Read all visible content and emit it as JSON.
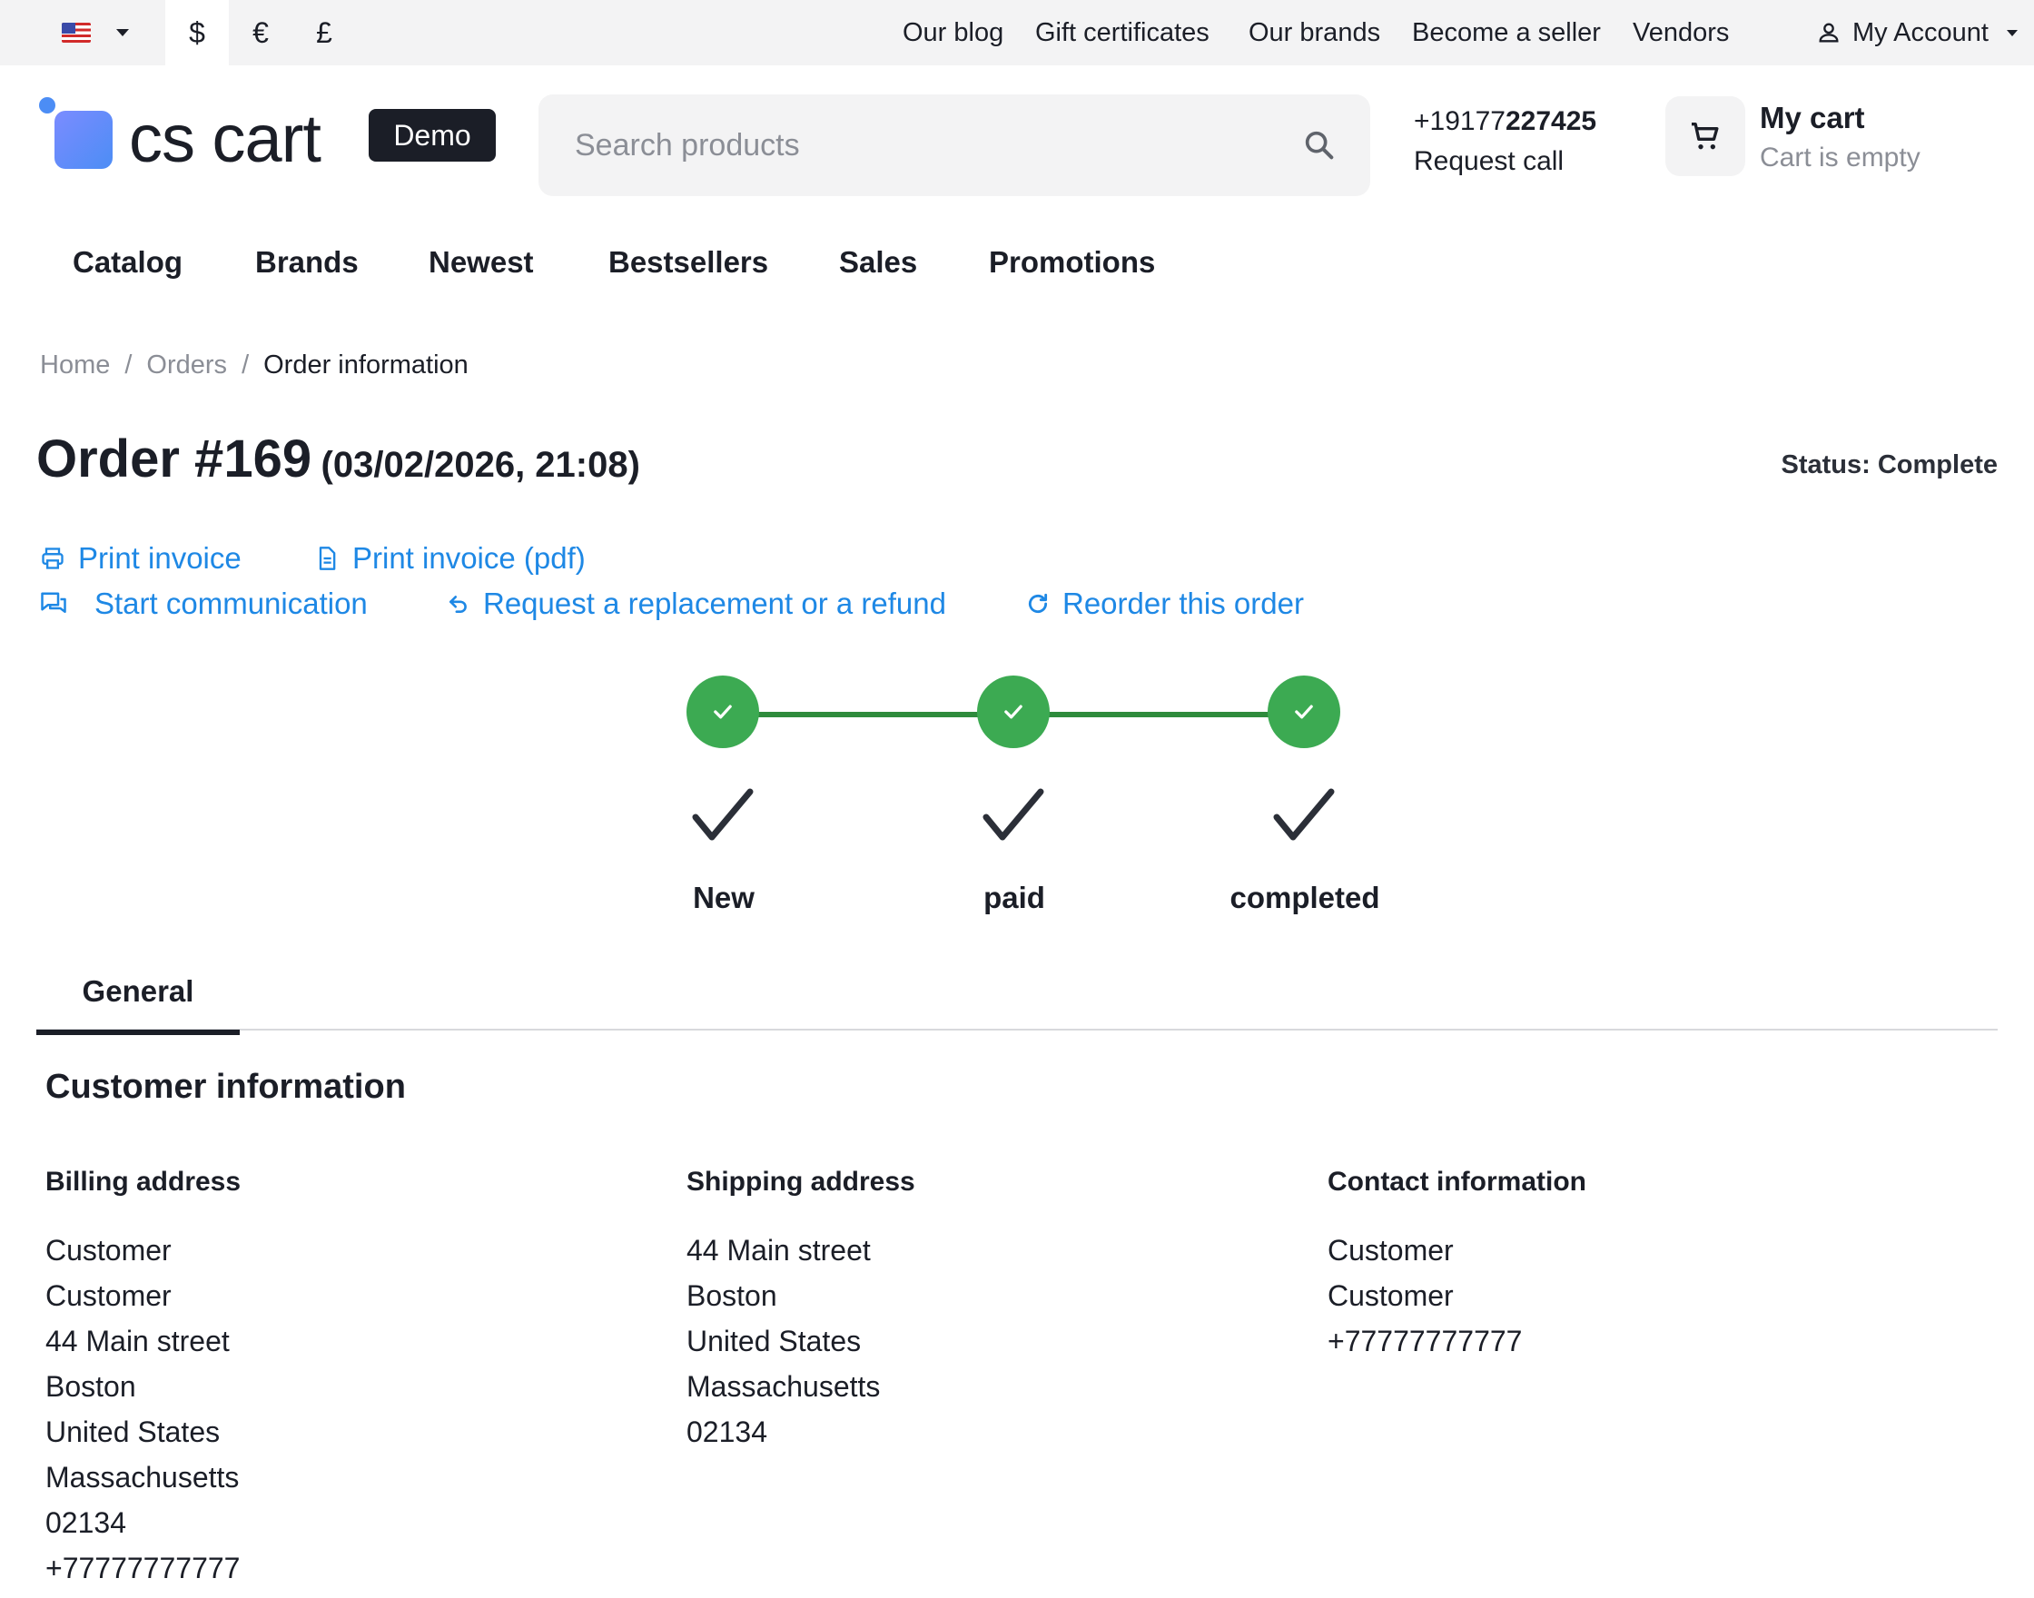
{
  "topbar": {
    "currencies": [
      "$",
      "€",
      "£"
    ],
    "links": [
      "Our blog",
      "Gift certificates",
      "Our brands",
      "Become a seller",
      "Vendors"
    ],
    "account_label": "My Account"
  },
  "header": {
    "logo_text": "cs cart",
    "demo_badge": "Demo",
    "search_placeholder": "Search products",
    "phone_prefix": "+19177",
    "phone_bold": "227425",
    "request_call": "Request call",
    "cart_title": "My cart",
    "cart_status": "Cart is empty"
  },
  "nav": [
    "Catalog",
    "Brands",
    "Newest",
    "Bestsellers",
    "Sales",
    "Promotions"
  ],
  "breadcrumb": {
    "home": "Home",
    "orders": "Orders",
    "current": "Order information",
    "separator": "/"
  },
  "order": {
    "title": "Order #169",
    "date": "(03/02/2026, 21:08)",
    "status": "Status: Complete"
  },
  "actions": {
    "print_invoice": "Print invoice",
    "print_pdf": "Print invoice (pdf)",
    "start_communication": "Start communication",
    "request_refund": "Request a replacement or a refund",
    "reorder": "Reorder this order"
  },
  "steps": [
    "New",
    "paid",
    "completed"
  ],
  "tabs": {
    "general": "General"
  },
  "customer": {
    "title": "Customer information",
    "billing": {
      "heading": "Billing address",
      "lines": [
        "Customer",
        "Customer",
        "44 Main street",
        "Boston",
        "United States",
        "Massachusetts",
        "02134",
        "+77777777777"
      ]
    },
    "shipping": {
      "heading": "Shipping address",
      "lines": [
        "44 Main street",
        "Boston",
        "United States",
        "Massachusetts",
        "02134"
      ]
    },
    "contact": {
      "heading": "Contact information",
      "lines": [
        "Customer",
        "Customer",
        "+77777777777"
      ]
    }
  },
  "colors": {
    "link": "#1e88e5",
    "step_green": "#3caa52",
    "step_line": "#2e8b3c",
    "text": "#1b1e27",
    "muted": "#8b8e96"
  }
}
